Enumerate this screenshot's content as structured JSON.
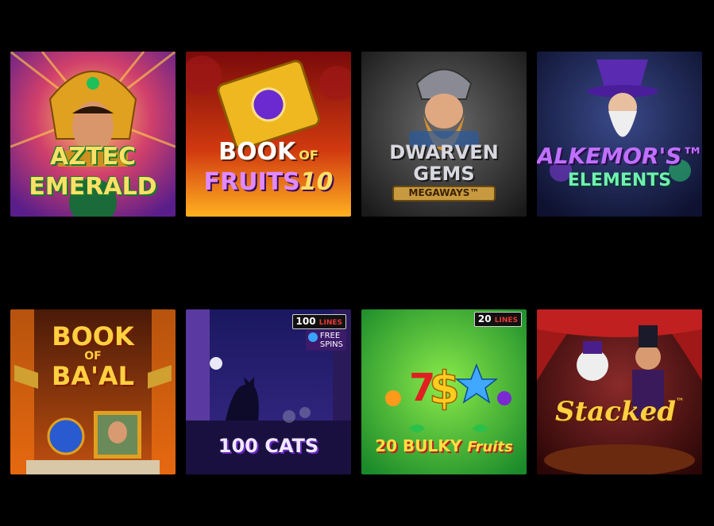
{
  "games": [
    {
      "title_line1": "AZTEC",
      "title_line2": "EMERALD"
    },
    {
      "title_line1": "BOOK",
      "title_of": "OF",
      "title_line2": "FRUITS",
      "title_num": "10"
    },
    {
      "title_line1": "DWARVEN",
      "title_line2": "GEMS",
      "title_line3": "MEGAWAYS™"
    },
    {
      "title_line1": "ALKEMOR'S™",
      "title_line2": "ELEMENTS"
    },
    {
      "title_line1": "BOOK",
      "title_of": "OF",
      "title_line2": "BA'AL"
    },
    {
      "title_line1": "100 CATS",
      "badge_num": "100",
      "badge_lines": "LINES",
      "badge_free": "FREE",
      "badge_spins": "SPINS"
    },
    {
      "title_line1": "20 BULKY",
      "title_line2": "Fruits",
      "badge_num": "20",
      "badge_lines": "LINES"
    },
    {
      "title_line1": "Stacked",
      "title_tm": "™"
    }
  ]
}
